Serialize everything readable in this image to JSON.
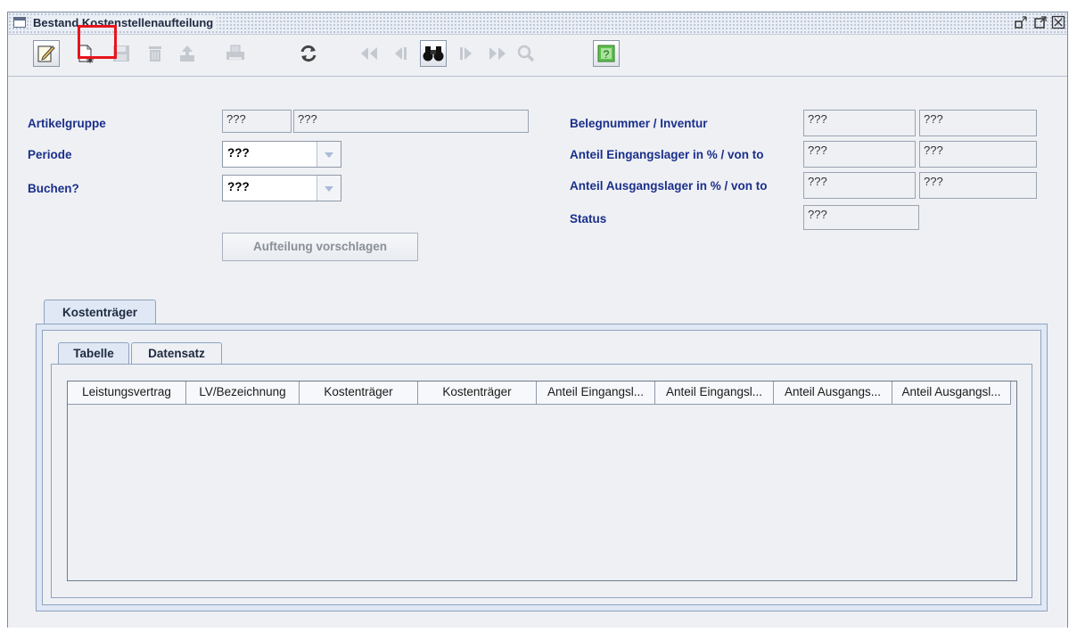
{
  "window": {
    "title": "Bestand Kostenstellenaufteilung",
    "controls": [
      "minimize-icon",
      "maximize-icon",
      "close-icon"
    ]
  },
  "toolbar": {
    "buttons": [
      {
        "name": "edit-button",
        "icon": "pencil-note-icon",
        "state": "active"
      },
      {
        "name": "new-record-button",
        "icon": "new-document-icon",
        "state": "enabled",
        "highlighted": true
      },
      {
        "name": "save-button",
        "icon": "floppy-disk-icon",
        "state": "disabled"
      },
      {
        "name": "delete-button",
        "icon": "trash-icon",
        "state": "disabled"
      },
      {
        "name": "export-button",
        "icon": "upload-icon",
        "state": "disabled"
      },
      {
        "name": "print-button",
        "icon": "printer-icon",
        "state": "disabled"
      },
      {
        "name": "refresh-button",
        "icon": "refresh-arrows-icon",
        "state": "enabled"
      },
      {
        "name": "first-record-button",
        "icon": "double-left-arrow-icon",
        "state": "disabled"
      },
      {
        "name": "previous-record-button",
        "icon": "left-arrow-icon",
        "state": "disabled"
      },
      {
        "name": "search-button",
        "icon": "binoculars-icon",
        "state": "active"
      },
      {
        "name": "next-record-button",
        "icon": "right-arrow-icon",
        "state": "disabled"
      },
      {
        "name": "last-record-button",
        "icon": "double-right-arrow-icon",
        "state": "disabled"
      },
      {
        "name": "zoom-button",
        "icon": "magnifier-icon",
        "state": "disabled"
      },
      {
        "name": "help-button",
        "icon": "help-icon",
        "state": "enabled"
      }
    ],
    "highlight_color": "#e8141c"
  },
  "form": {
    "artikelgruppe": {
      "label": "Artikelgruppe",
      "code": "???",
      "name": "???"
    },
    "periode": {
      "label": "Periode",
      "value": "???"
    },
    "buchen": {
      "label": "Buchen?",
      "value": "???"
    },
    "belegnummer": {
      "label": "Belegnummer / Inventur",
      "value1": "???",
      "value2": "???"
    },
    "anteil_eingang": {
      "label": "Anteil Eingangslager in % / von to",
      "value1": "???",
      "value2": "???"
    },
    "anteil_ausgang": {
      "label": "Anteil Ausgangslager in % / von to",
      "value1": "???",
      "value2": "???"
    },
    "status": {
      "label": "Status",
      "value": "???"
    },
    "suggest_button": "Aufteilung vorschlagen"
  },
  "tabs": {
    "outer": [
      "Kostenträger"
    ],
    "inner": [
      "Tabelle",
      "Datensatz"
    ]
  },
  "table": {
    "columns": [
      "Leistungsvertrag",
      "LV/Bezeichnung",
      "Kostenträger",
      "Kostenträger",
      "Anteil Eingangsl...",
      "Anteil Eingangsl...",
      "Anteil Ausgangs...",
      "Anteil Ausgangsl..."
    ],
    "rows": []
  },
  "colors": {
    "label_blue": "#1b2f8a",
    "tab_border": "#8ea2bf",
    "highlight": "#e8141c"
  }
}
